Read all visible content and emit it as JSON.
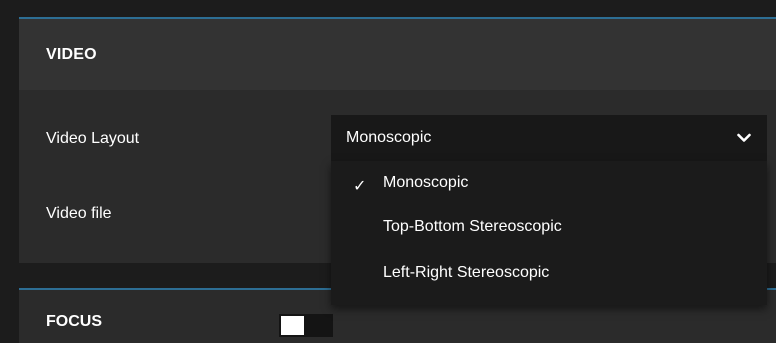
{
  "video": {
    "section_title": "VIDEO",
    "layout_label": "Video Layout",
    "file_label": "Video file",
    "layout_select": {
      "selected": "Monoscopic",
      "options": [
        {
          "label": "Monoscopic",
          "checked": true,
          "check": "✓"
        },
        {
          "label": "Top-Bottom Stereoscopic",
          "checked": false
        },
        {
          "label": "Left-Right Stereoscopic",
          "checked": false
        }
      ]
    }
  },
  "focus": {
    "section_title": "FOCUS",
    "toggle_on": false
  },
  "colors": {
    "accent_border": "#2d6e94",
    "panel_bg": "#2b2b2b",
    "header_bg": "#333333",
    "select_bg": "#181818"
  },
  "icons": [
    "chevron-down-icon",
    "checkmark-icon"
  ]
}
